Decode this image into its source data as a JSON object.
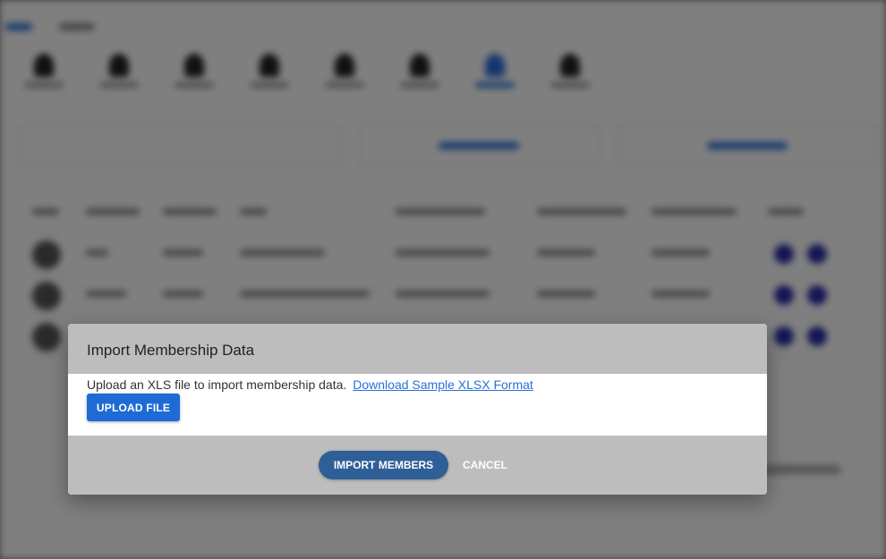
{
  "dialog": {
    "title": "Import Membership Data",
    "description": "Upload an XLS file to import membership data.",
    "sample_link": "Download Sample XLSX Format",
    "upload_label": "UPLOAD FILE",
    "import_label": "IMPORT MEMBERS",
    "cancel_label": "CANCEL"
  },
  "colors": {
    "primary": "#1e6bd6",
    "import_button": "#2f5f97",
    "dialog_bar": "#bdbdbd",
    "link": "#2a6fdb"
  }
}
